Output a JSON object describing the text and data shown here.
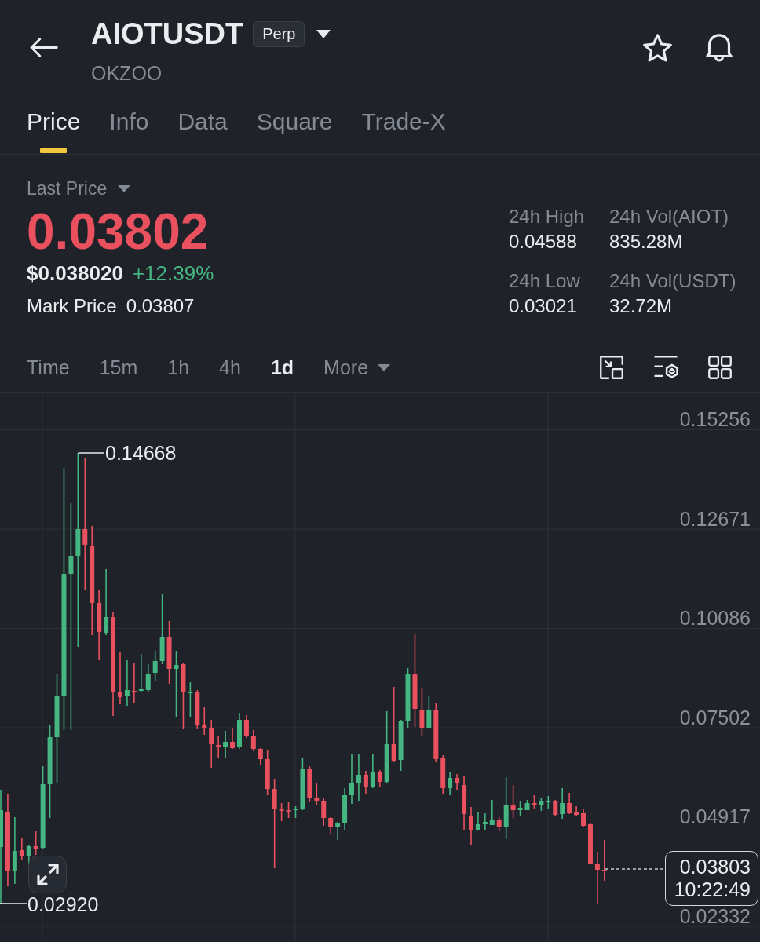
{
  "header": {
    "symbol": "AIOTUSDT",
    "badge": "Perp",
    "subtitle": "OKZOO"
  },
  "tabs": [
    {
      "label": "Price",
      "selected": true
    },
    {
      "label": "Info",
      "selected": false
    },
    {
      "label": "Data",
      "selected": false
    },
    {
      "label": "Square",
      "selected": false
    },
    {
      "label": "Trade-X",
      "selected": false
    }
  ],
  "market": {
    "last_price_label": "Last Price",
    "last_price": "0.03802",
    "last_price_down": true,
    "usd_price": "$0.038020",
    "change": "+12.39%",
    "change_up": true,
    "mark_price_label": "Mark Price",
    "mark_price": "0.03807"
  },
  "stats": [
    {
      "label": "24h High",
      "value": "0.04588"
    },
    {
      "label": "24h Vol(AIOT)",
      "value": "835.28M"
    },
    {
      "label": "24h Low",
      "value": "0.03021"
    },
    {
      "label": "24h Vol(USDT)",
      "value": "32.72M"
    }
  ],
  "intervals": [
    {
      "label": "Time",
      "kind": "option",
      "selected": false
    },
    {
      "label": "15m",
      "kind": "option",
      "selected": false
    },
    {
      "label": "1h",
      "kind": "option",
      "selected": false
    },
    {
      "label": "4h",
      "kind": "option",
      "selected": false
    },
    {
      "label": "1d",
      "kind": "option",
      "selected": true
    },
    {
      "label": "More",
      "kind": "menu",
      "selected": false
    }
  ],
  "chart": {
    "y_labels": [
      "0.15256",
      "0.12671",
      "0.10086",
      "0.07502",
      "0.04917",
      "0.02332"
    ],
    "high_label": "0.14668",
    "low_label": "0.02920",
    "last_price": "0.03803",
    "countdown": "10:22:49"
  }
}
